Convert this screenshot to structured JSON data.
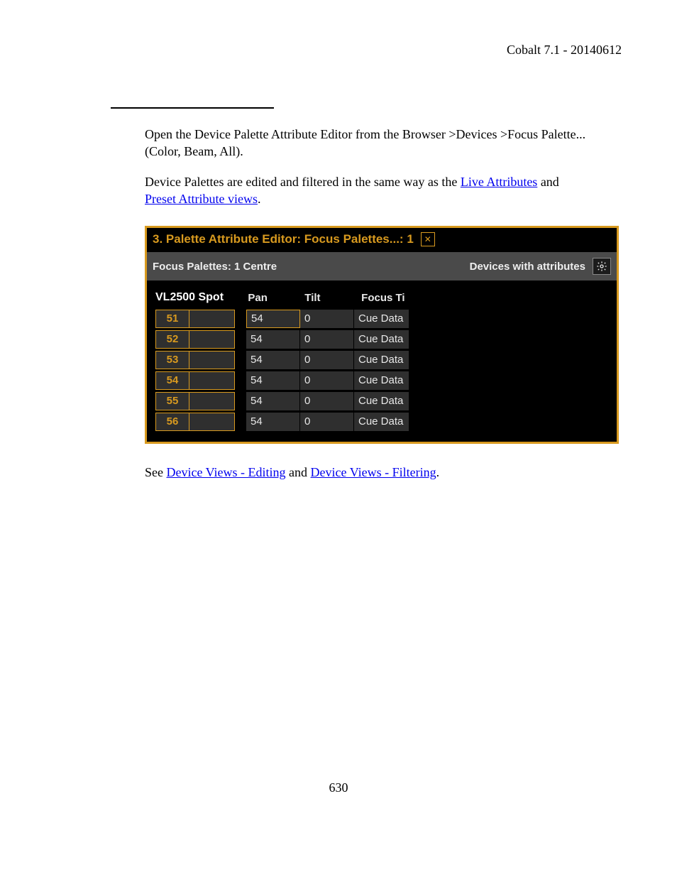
{
  "doc": {
    "header": "Cobalt 7.1 - 20140612",
    "page_number": "630",
    "para1": "Open the Device Palette Attribute Editor from the Browser >Devices >Focus Palette... (Color, Beam, All).",
    "para2_pre": "Device Palettes are edited and filtered in the same way as the ",
    "para2_link1": "Live Attributes",
    "para2_mid": " and ",
    "para2_link2": "Preset Attribute views",
    "para2_post": ".",
    "para3_pre": "See ",
    "para3_link1": "Device Views - Editing",
    "para3_mid": " and ",
    "para3_link2": "Device Views - Filtering",
    "para3_post": "."
  },
  "editor": {
    "title": "3. Palette Attribute Editor: Focus Palettes...: 1",
    "subbar_left": "Focus Palettes: 1 Centre",
    "subbar_right": "Devices with attributes",
    "device_name": "VL2500 Spot",
    "cols": {
      "pan": "Pan",
      "tilt": "Tilt",
      "focus": "Focus Ti"
    },
    "rows": [
      {
        "id": "51",
        "pan": "54",
        "tilt": "0",
        "ft": "Cue Data",
        "sel": true
      },
      {
        "id": "52",
        "pan": "54",
        "tilt": "0",
        "ft": "Cue Data",
        "sel": false
      },
      {
        "id": "53",
        "pan": "54",
        "tilt": "0",
        "ft": "Cue Data",
        "sel": false
      },
      {
        "id": "54",
        "pan": "54",
        "tilt": "0",
        "ft": "Cue Data",
        "sel": false
      },
      {
        "id": "55",
        "pan": "54",
        "tilt": "0",
        "ft": "Cue Data",
        "sel": false
      },
      {
        "id": "56",
        "pan": "54",
        "tilt": "0",
        "ft": "Cue Data",
        "sel": false
      }
    ]
  }
}
